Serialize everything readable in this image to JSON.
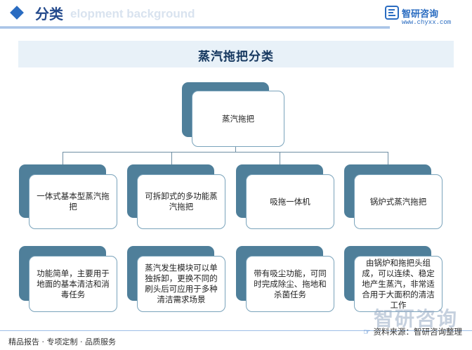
{
  "header": {
    "title": "分类",
    "watermark_text": "elopment background",
    "brand_name": "智研咨询",
    "brand_url": "www.chyxx.com"
  },
  "title": "蒸汽拖把分类",
  "root": {
    "label": "蒸汽拖把"
  },
  "categories": [
    {
      "label": "一体式基本型蒸汽拖把",
      "desc": "功能简单，主要用于地面的基本清洁和消毒任务"
    },
    {
      "label": "可拆卸式的多功能蒸汽拖把",
      "desc": "蒸汽发生模块可以单独拆卸，更换不同的刷头后可应用于多种清洁需求场景"
    },
    {
      "label": "吸拖一体机",
      "desc": "带有吸尘功能，可同时完成除尘、拖地和杀菌任务"
    },
    {
      "label": "锅炉式蒸汽拖把",
      "desc": "由锅炉和拖把头组成，可以连续、稳定地产生蒸汽，非常适合用于大面积的清洁工作"
    }
  ],
  "footer": {
    "left": "精品报告 · 专项定制 · 品质服务",
    "source": "资料来源：智研咨询整理",
    "big_brand": "智研咨询"
  },
  "colors": {
    "accent": "#2a6cc1",
    "node_back": "#4f7f9a",
    "node_border": "#7aa3bb"
  }
}
